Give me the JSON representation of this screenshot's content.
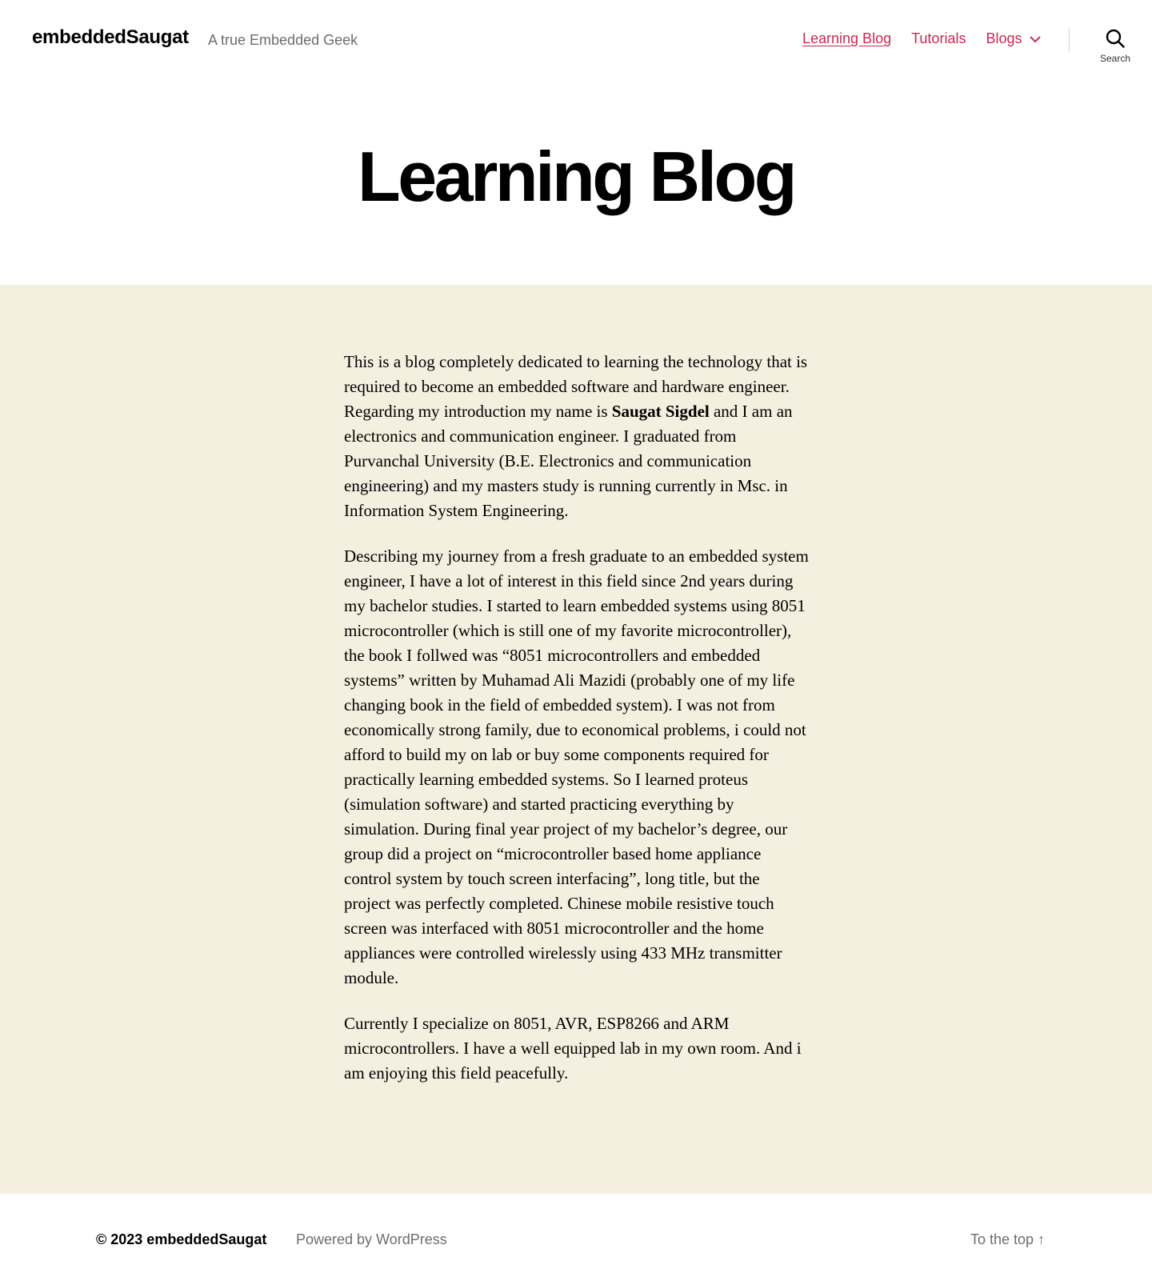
{
  "header": {
    "site_title": "embeddedSaugat",
    "tagline": "A true Embedded Geek",
    "nav": {
      "learning_blog": "Learning Blog",
      "tutorials": "Tutorials",
      "blogs": "Blogs"
    },
    "search_label": "Search"
  },
  "page": {
    "title": "Learning Blog",
    "paragraphs": [
      {
        "before": "This is a blog completely dedicated to learning the technology that is required to become an embedded software and hardware engineer. Regarding my introduction my name is ",
        "bold": "Saugat Sigdel",
        "after": " and I am an electronics and communication engineer. I graduated from Purvanchal University (B.E. Electronics and communication engineering) and my masters study is running currently in Msc. in Information System Engineering."
      },
      {
        "text": "Describing my journey from a fresh graduate to an embedded system engineer, I have a lot of interest in this field since 2nd years during my bachelor studies. I started to learn embedded systems using 8051 microcontroller (which is still one of my favorite microcontroller), the book I follwed was “8051 microcontrollers and embedded systems” written by Muhamad Ali Mazidi (probably one of my life changing book in the field of embedded system). I was not from economically strong family, due to economical problems, i could not afford to build my on lab or buy some components required for practically learning embedded systems. So I learned proteus (simulation software) and started practicing everything by simulation. During final year project of my bachelor’s degree, our group did a project on “microcontroller based home appliance control system by touch screen interfacing”, long title, but the project was perfectly completed. Chinese mobile resistive touch screen was interfaced with 8051 microcontroller and the home appliances were controlled wirelessly using 433 MHz transmitter module."
      },
      {
        "text": "Currently I specialize on 8051, AVR, ESP8266 and ARM microcontrollers. I have a well equipped lab in my own room. And i am enjoying this field peacefully."
      }
    ]
  },
  "footer": {
    "copyright": "© 2023 embeddedSaugat",
    "powered_by": "Powered by WordPress",
    "to_the_top": "To the top ↑"
  },
  "colors": {
    "accent": "#cd2653",
    "content_background": "#f5efe0",
    "secondary_text": "#6d6d6d"
  }
}
